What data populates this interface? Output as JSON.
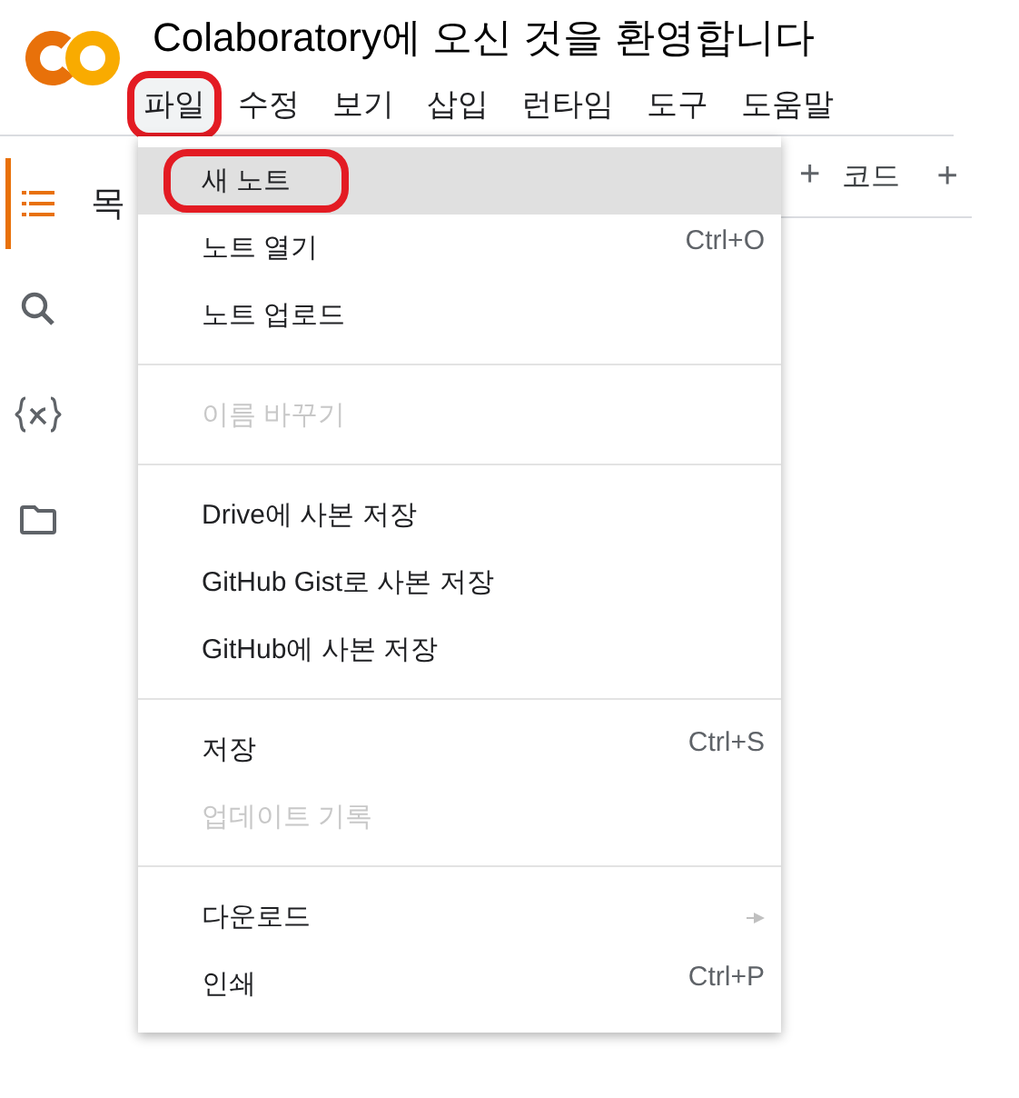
{
  "header": {
    "title": "Colaboratory에 오신 것을 환영합니다"
  },
  "menubar": [
    {
      "label": "파일",
      "selected": true,
      "highlighted": true
    },
    {
      "label": "수정",
      "selected": false,
      "highlighted": false
    },
    {
      "label": "보기",
      "selected": false,
      "highlighted": false
    },
    {
      "label": "삽입",
      "selected": false,
      "highlighted": false
    },
    {
      "label": "런타임",
      "selected": false,
      "highlighted": false
    },
    {
      "label": "도구",
      "selected": false,
      "highlighted": false
    },
    {
      "label": "도움말",
      "selected": false,
      "highlighted": false
    }
  ],
  "sidebar": {
    "icons": [
      {
        "kind": "toc",
        "selected": true
      },
      {
        "kind": "search",
        "selected": false
      },
      {
        "kind": "variables",
        "selected": false
      },
      {
        "kind": "files",
        "selected": false
      }
    ]
  },
  "panel": {
    "title": "목"
  },
  "toolbar": [
    {
      "icon": "+",
      "label": "코드"
    },
    {
      "icon": "+"
    }
  ],
  "file_menu": [
    {
      "kind": "item",
      "label": "새 노트",
      "selected": true,
      "highlighted": true,
      "disabled": false
    },
    {
      "kind": "item",
      "label": "노트 열기",
      "shortcut": "Ctrl+O",
      "selected": false,
      "highlighted": false,
      "disabled": false
    },
    {
      "kind": "item",
      "label": "노트 업로드",
      "selected": false,
      "highlighted": false,
      "disabled": false
    },
    {
      "kind": "divider"
    },
    {
      "kind": "item",
      "label": "이름 바꾸기",
      "selected": false,
      "highlighted": false,
      "disabled": true
    },
    {
      "kind": "divider"
    },
    {
      "kind": "item",
      "label": "Drive에 사본 저장",
      "selected": false,
      "highlighted": false,
      "disabled": false
    },
    {
      "kind": "item",
      "label": "GitHub Gist로 사본 저장",
      "selected": false,
      "highlighted": false,
      "disabled": false
    },
    {
      "kind": "item",
      "label": "GitHub에 사본 저장",
      "selected": false,
      "highlighted": false,
      "disabled": false
    },
    {
      "kind": "divider"
    },
    {
      "kind": "item",
      "label": "저장",
      "shortcut": "Ctrl+S",
      "selected": false,
      "highlighted": false,
      "disabled": false
    },
    {
      "kind": "item",
      "label": "업데이트 기록",
      "selected": false,
      "highlighted": false,
      "disabled": true
    },
    {
      "kind": "divider"
    },
    {
      "kind": "submenu",
      "label": "다운로드",
      "selected": false,
      "highlighted": false,
      "disabled": false
    },
    {
      "kind": "item",
      "label": "인쇄",
      "shortcut": "Ctrl+P",
      "selected": false,
      "highlighted": false,
      "disabled": false
    }
  ]
}
